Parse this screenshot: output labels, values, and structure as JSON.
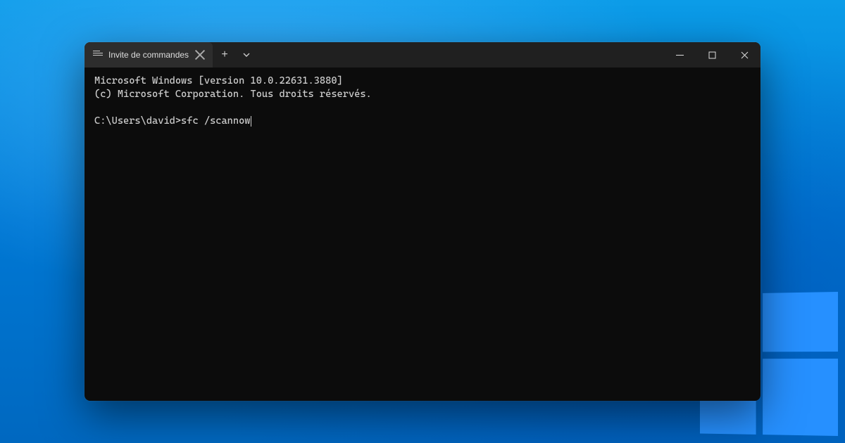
{
  "window": {
    "tab_title": "Invite de commandes",
    "new_tab_label": "+"
  },
  "terminal": {
    "line1": "Microsoft Windows [version 10.0.22631.3880]",
    "line2": "(c) Microsoft Corporation. Tous droits réservés.",
    "prompt": "C:\\Users\\david>",
    "command": "sfc /scannow"
  }
}
